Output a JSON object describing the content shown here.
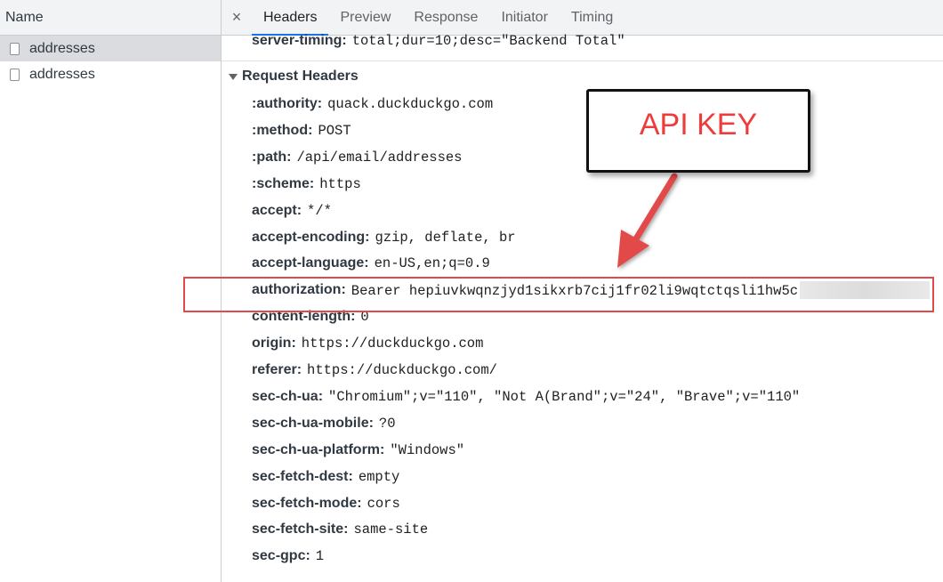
{
  "left_pane": {
    "header": "Name",
    "requests": [
      {
        "name": "addresses",
        "selected": true
      },
      {
        "name": "addresses",
        "selected": false
      }
    ]
  },
  "tabs": {
    "close_glyph": "×",
    "items": [
      "Headers",
      "Preview",
      "Response",
      "Initiator",
      "Timing"
    ],
    "active": "Headers"
  },
  "top_partial_header": {
    "name": "server-timing:",
    "value": "total;dur=10;desc=\"Backend Total\""
  },
  "section": {
    "title": "Request Headers"
  },
  "headers": [
    {
      "name": ":authority:",
      "value": "quack.duckduckgo.com"
    },
    {
      "name": ":method:",
      "value": "POST"
    },
    {
      "name": ":path:",
      "value": "/api/email/addresses"
    },
    {
      "name": ":scheme:",
      "value": "https"
    },
    {
      "name": "accept:",
      "value": "*/*"
    },
    {
      "name": "accept-encoding:",
      "value": "gzip, deflate, br"
    },
    {
      "name": "accept-language:",
      "value": "en-US,en;q=0.9"
    },
    {
      "name": "authorization:",
      "value": "Bearer hepiuvkwqnzjyd1sikxrb7cij1fr02li9wqtctqsli1hw5c"
    },
    {
      "name": "content-length:",
      "value": "0"
    },
    {
      "name": "origin:",
      "value": "https://duckduckgo.com"
    },
    {
      "name": "referer:",
      "value": "https://duckduckgo.com/"
    },
    {
      "name": "sec-ch-ua:",
      "value": "\"Chromium\";v=\"110\", \"Not A(Brand\";v=\"24\", \"Brave\";v=\"110\""
    },
    {
      "name": "sec-ch-ua-mobile:",
      "value": "?0"
    },
    {
      "name": "sec-ch-ua-platform:",
      "value": "\"Windows\""
    },
    {
      "name": "sec-fetch-dest:",
      "value": "empty"
    },
    {
      "name": "sec-fetch-mode:",
      "value": "cors"
    },
    {
      "name": "sec-fetch-site:",
      "value": "same-site"
    },
    {
      "name": "sec-gpc:",
      "value": "1"
    }
  ],
  "annotation": {
    "callout_text": "API KEY",
    "color": "#ee3b3b"
  },
  "colors": {
    "accent": "#1a73e8",
    "highlight": "#e24a4a"
  }
}
